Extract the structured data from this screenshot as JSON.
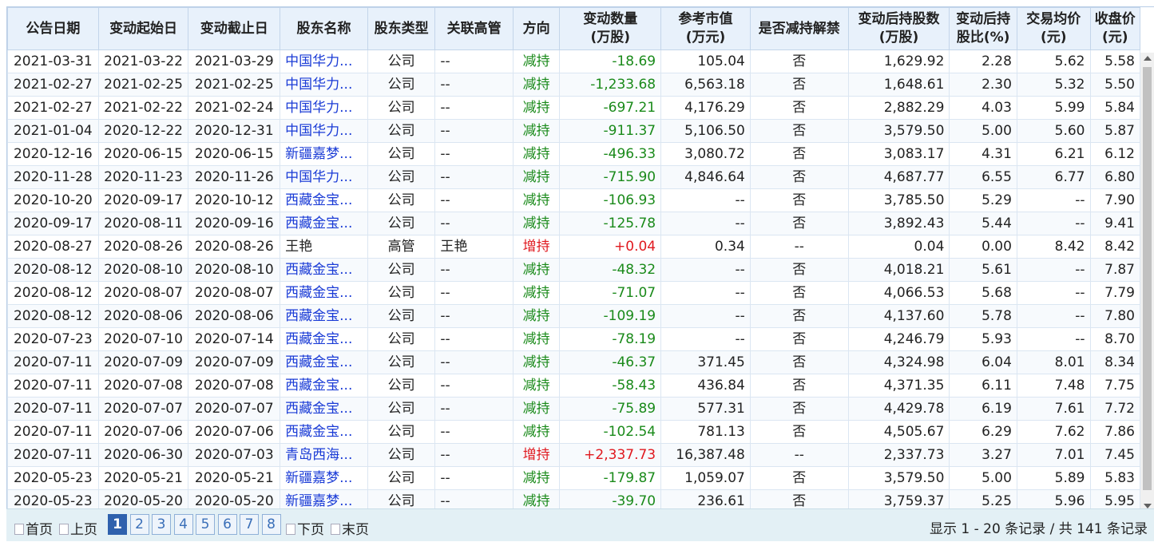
{
  "headers": [
    [
      "公告日期"
    ],
    [
      "变动起始日"
    ],
    [
      "变动截止日"
    ],
    [
      "股东名称"
    ],
    [
      "股东类型"
    ],
    [
      "关联高管"
    ],
    [
      "方向"
    ],
    [
      "变动数量",
      "(万股)"
    ],
    [
      "参考市值",
      "(万元)"
    ],
    [
      "是否减持解禁"
    ],
    [
      "变动后持股数",
      "(万股)"
    ],
    [
      "变动后持",
      "股比(%)"
    ],
    [
      "交易均价",
      "(元)"
    ],
    [
      "收盘价",
      "(元)"
    ]
  ],
  "rows": [
    [
      "2021-03-31",
      "2021-03-22",
      "2021-03-29",
      "中国华力...",
      "公司",
      "--",
      "减持",
      "-18.69",
      "105.04",
      "否",
      "1,629.92",
      "2.28",
      "5.62",
      "5.58"
    ],
    [
      "2021-02-27",
      "2021-02-25",
      "2021-02-25",
      "中国华力...",
      "公司",
      "--",
      "减持",
      "-1,233.68",
      "6,563.18",
      "否",
      "1,648.61",
      "2.30",
      "5.32",
      "5.50"
    ],
    [
      "2021-02-27",
      "2021-02-22",
      "2021-02-24",
      "中国华力...",
      "公司",
      "--",
      "减持",
      "-697.21",
      "4,176.29",
      "否",
      "2,882.29",
      "4.03",
      "5.99",
      "5.84"
    ],
    [
      "2021-01-04",
      "2020-12-22",
      "2020-12-31",
      "中国华力...",
      "公司",
      "--",
      "减持",
      "-911.37",
      "5,106.50",
      "否",
      "3,579.50",
      "5.00",
      "5.60",
      "5.87"
    ],
    [
      "2020-12-16",
      "2020-06-15",
      "2020-06-15",
      "新疆嘉梦...",
      "公司",
      "--",
      "减持",
      "-496.33",
      "3,080.72",
      "否",
      "3,083.17",
      "4.31",
      "6.21",
      "6.12"
    ],
    [
      "2020-11-28",
      "2020-11-23",
      "2020-11-26",
      "中国华力...",
      "公司",
      "--",
      "减持",
      "-715.90",
      "4,846.64",
      "否",
      "4,687.77",
      "6.55",
      "6.77",
      "6.80"
    ],
    [
      "2020-10-20",
      "2020-09-17",
      "2020-10-12",
      "西藏金宝...",
      "公司",
      "--",
      "减持",
      "-106.93",
      "--",
      "否",
      "3,785.50",
      "5.29",
      "--",
      "7.90"
    ],
    [
      "2020-09-17",
      "2020-08-11",
      "2020-09-16",
      "西藏金宝...",
      "公司",
      "--",
      "减持",
      "-125.78",
      "--",
      "否",
      "3,892.43",
      "5.44",
      "--",
      "9.41"
    ],
    [
      "2020-08-27",
      "2020-08-26",
      "2020-08-26",
      "王艳",
      "高管",
      "王艳",
      "增持",
      "+0.04",
      "0.34",
      "--",
      "0.04",
      "0.00",
      "8.42",
      "8.42"
    ],
    [
      "2020-08-12",
      "2020-08-10",
      "2020-08-10",
      "西藏金宝...",
      "公司",
      "--",
      "减持",
      "-48.32",
      "--",
      "否",
      "4,018.21",
      "5.61",
      "--",
      "7.87"
    ],
    [
      "2020-08-12",
      "2020-08-07",
      "2020-08-07",
      "西藏金宝...",
      "公司",
      "--",
      "减持",
      "-71.07",
      "--",
      "否",
      "4,066.53",
      "5.68",
      "--",
      "7.79"
    ],
    [
      "2020-08-12",
      "2020-08-06",
      "2020-08-06",
      "西藏金宝...",
      "公司",
      "--",
      "减持",
      "-109.19",
      "--",
      "否",
      "4,137.60",
      "5.78",
      "--",
      "7.80"
    ],
    [
      "2020-07-23",
      "2020-07-10",
      "2020-07-14",
      "西藏金宝...",
      "公司",
      "--",
      "减持",
      "-78.19",
      "--",
      "否",
      "4,246.79",
      "5.93",
      "--",
      "8.70"
    ],
    [
      "2020-07-11",
      "2020-07-09",
      "2020-07-09",
      "西藏金宝...",
      "公司",
      "--",
      "减持",
      "-46.37",
      "371.45",
      "否",
      "4,324.98",
      "6.04",
      "8.01",
      "8.34"
    ],
    [
      "2020-07-11",
      "2020-07-08",
      "2020-07-08",
      "西藏金宝...",
      "公司",
      "--",
      "减持",
      "-58.43",
      "436.84",
      "否",
      "4,371.35",
      "6.11",
      "7.48",
      "7.75"
    ],
    [
      "2020-07-11",
      "2020-07-07",
      "2020-07-07",
      "西藏金宝...",
      "公司",
      "--",
      "减持",
      "-75.89",
      "577.31",
      "否",
      "4,429.78",
      "6.19",
      "7.61",
      "7.72"
    ],
    [
      "2020-07-11",
      "2020-07-06",
      "2020-07-06",
      "西藏金宝...",
      "公司",
      "--",
      "减持",
      "-102.54",
      "781.13",
      "否",
      "4,505.67",
      "6.29",
      "7.62",
      "7.86"
    ],
    [
      "2020-07-11",
      "2020-06-30",
      "2020-07-03",
      "青岛西海...",
      "公司",
      "--",
      "增持",
      "+2,337.73",
      "16,387.48",
      "--",
      "2,337.73",
      "3.27",
      "7.01",
      "7.45"
    ],
    [
      "2020-05-23",
      "2020-05-21",
      "2020-05-21",
      "新疆嘉梦...",
      "公司",
      "--",
      "减持",
      "-179.87",
      "1,059.07",
      "否",
      "3,579.50",
      "5.00",
      "5.89",
      "5.83"
    ],
    [
      "2020-05-23",
      "2020-05-20",
      "2020-05-20",
      "新疆嘉梦...",
      "公司",
      "--",
      "减持",
      "-39.70",
      "236.61",
      "否",
      "3,759.37",
      "5.25",
      "5.96",
      "5.95"
    ]
  ],
  "name_plain_rows": [
    8
  ],
  "pager": {
    "first": "首页",
    "prev": "上页",
    "pages": [
      "1",
      "2",
      "3",
      "4",
      "5",
      "6",
      "7",
      "8"
    ],
    "current": "1",
    "next": "下页",
    "last": "末页",
    "summary": "显示 1 - 20 条记录 / 共 141 条记录"
  }
}
